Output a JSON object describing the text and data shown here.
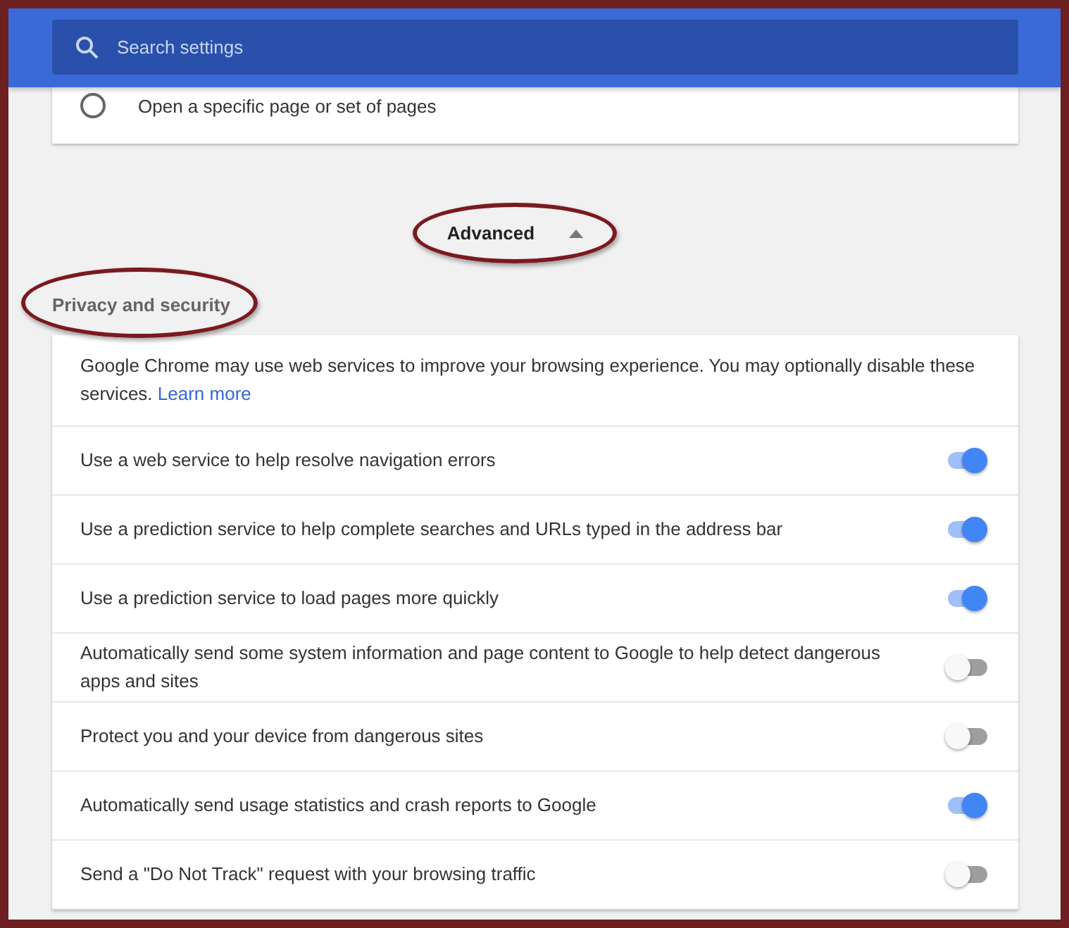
{
  "search": {
    "placeholder": "Search settings"
  },
  "startup_options": [
    {
      "label": "Open a specific page or set of pages",
      "selected": false
    }
  ],
  "advanced": {
    "label": "Advanced",
    "expanded": true,
    "circled": true
  },
  "section": {
    "title": "Privacy and security",
    "circled": true
  },
  "intro": {
    "text": "Google Chrome may use web services to improve your browsing experience. You may optionally disable these services.",
    "link": "Learn more"
  },
  "settings": [
    {
      "label": "Use a web service to help resolve navigation errors",
      "on": true
    },
    {
      "label": "Use a prediction service to help complete searches and URLs typed in the address bar",
      "on": true
    },
    {
      "label": "Use a prediction service to load pages more quickly",
      "on": true
    },
    {
      "label": "Automatically send some system information and page content to Google to help detect dangerous apps and sites",
      "on": false
    },
    {
      "label": "Protect you and your device from dangerous sites",
      "on": false
    },
    {
      "label": "Automatically send usage statistics and crash reports to Google",
      "on": true
    },
    {
      "label": "Send a \"Do Not Track\" request with your browsing traffic",
      "on": false
    }
  ]
}
